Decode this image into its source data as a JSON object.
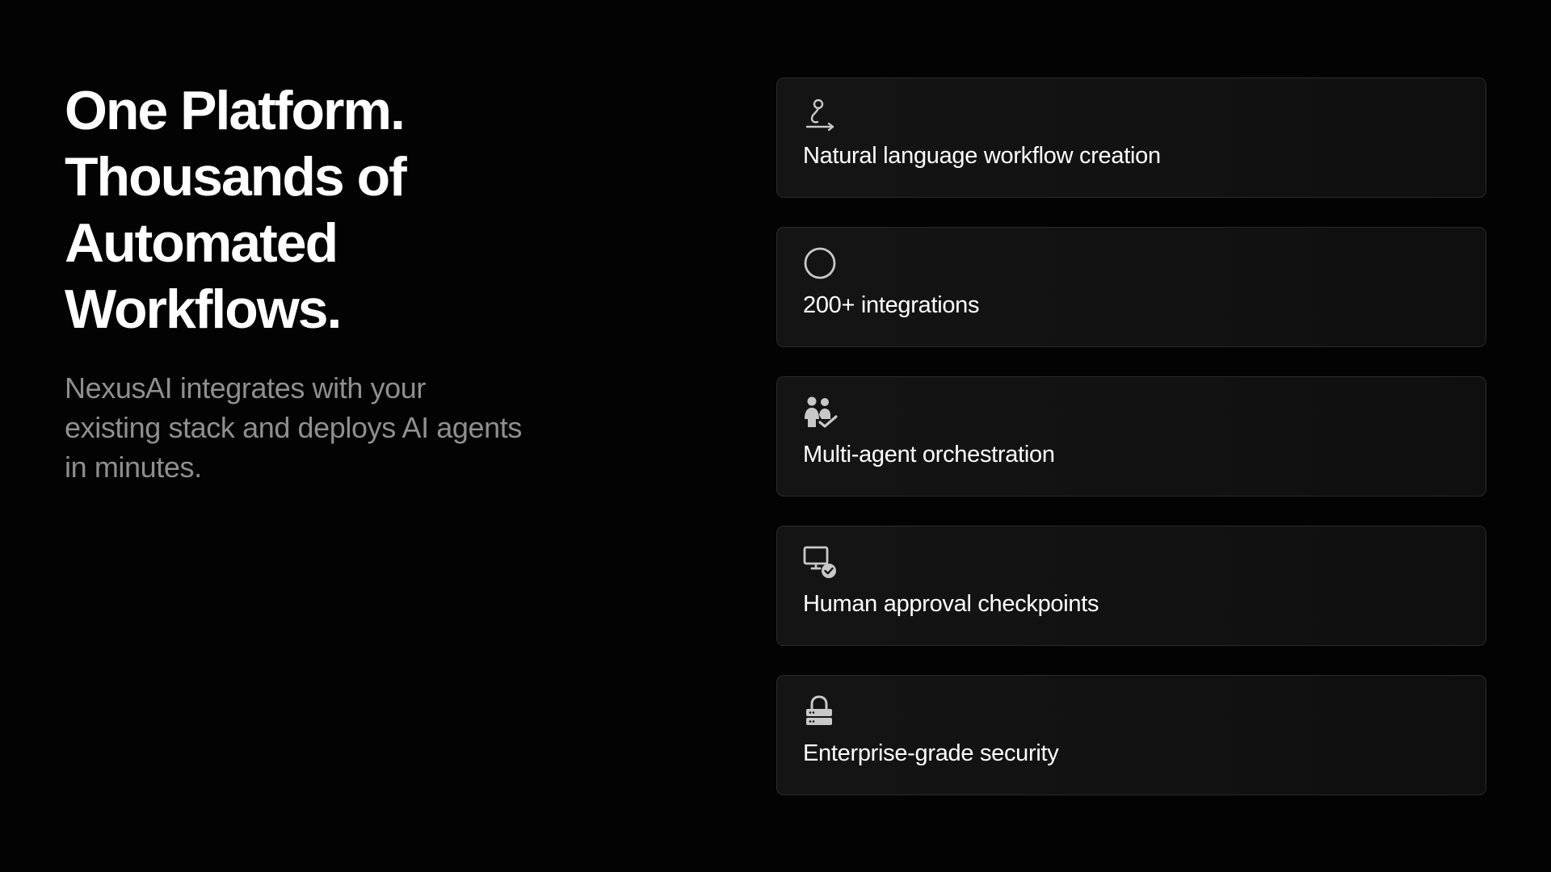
{
  "hero": {
    "headline_lines": [
      "One Platform.",
      "Thousands of",
      "Automated",
      "Workflows."
    ],
    "subhead_lines": [
      "NexusAI integrates with your",
      "existing stack and deploys AI agents",
      "in minutes."
    ]
  },
  "features": [
    {
      "icon": "workflow-icon",
      "label": "Natural language workflow creation"
    },
    {
      "icon": "circle-icon",
      "label": "200+ integrations"
    },
    {
      "icon": "users-icon",
      "label": "Multi-agent orchestration"
    },
    {
      "icon": "monitor-check-icon",
      "label": "Human approval checkpoints"
    },
    {
      "icon": "lock-server-icon",
      "label": "Enterprise-grade security"
    }
  ],
  "colors": {
    "background": "#030303",
    "card_background": "#131313",
    "card_border": "#2a2a2a",
    "headline": "#ffffff",
    "subhead": "#8f8f8f",
    "icon": "#c8c8c8"
  }
}
